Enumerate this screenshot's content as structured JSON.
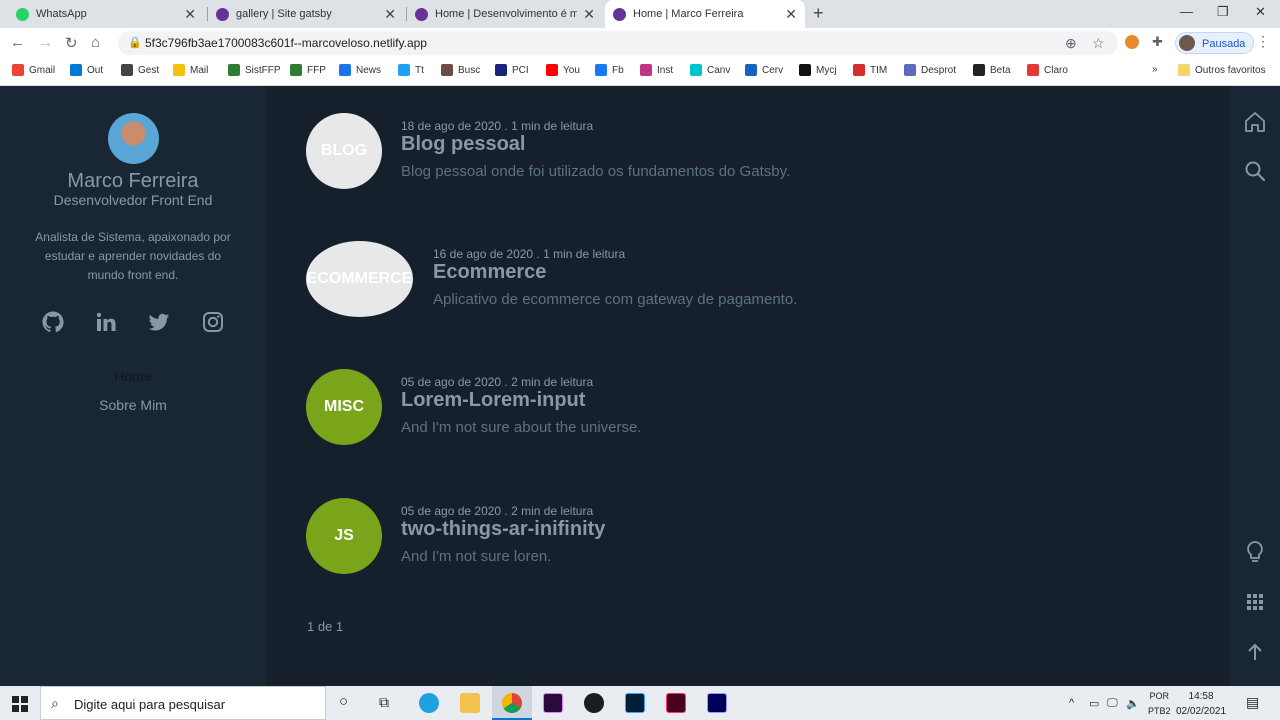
{
  "browser": {
    "tabs": [
      {
        "title": "WhatsApp",
        "active": false,
        "favicon_color": "#25d366"
      },
      {
        "title": "gallery | Site gatsby",
        "active": false,
        "favicon_color": "#663399"
      },
      {
        "title": "Home | Desenvolvimento é minh",
        "active": false,
        "favicon_color": "#663399"
      },
      {
        "title": "Home | Marco Ferreira",
        "active": true,
        "favicon_color": "#663399"
      }
    ],
    "new_tab": "+",
    "close": "✕",
    "url": "5f3c796fb3ae1700083c601f--marcoveloso.netlify.app",
    "profile_label": "Pausada",
    "bookmarks": [
      {
        "label": "Gmail",
        "color": "#ea4335"
      },
      {
        "label": "Out",
        "color": "#0078d4"
      },
      {
        "label": "Gest",
        "color": "#444444"
      },
      {
        "label": "Mail",
        "color": "#f4c20d"
      },
      {
        "label": "SistFFP",
        "color": "#2e7d32"
      },
      {
        "label": "FFP",
        "color": "#2e7d32"
      },
      {
        "label": "News",
        "color": "#1a73e8"
      },
      {
        "label": "Tt",
        "color": "#1da1f2"
      },
      {
        "label": "Busc",
        "color": "#6d4c41"
      },
      {
        "label": "PCI",
        "color": "#1a237e"
      },
      {
        "label": "You",
        "color": "#ff0000"
      },
      {
        "label": "Fb",
        "color": "#1877f2"
      },
      {
        "label": "Inst",
        "color": "#c13584"
      },
      {
        "label": "Canv",
        "color": "#00c4cc"
      },
      {
        "label": "Cerv",
        "color": "#1565c0"
      },
      {
        "label": "Mycj",
        "color": "#111111"
      },
      {
        "label": "TIM",
        "color": "#d32f2f"
      },
      {
        "label": "Desprot",
        "color": "#5c6bc0"
      },
      {
        "label": "Beta",
        "color": "#222222"
      },
      {
        "label": "Claro",
        "color": "#e53935"
      }
    ],
    "bookmarks_overflow": "»",
    "other_bookmarks": "Outros favoritos"
  },
  "sidebar": {
    "name": "Marco Ferreira",
    "role": "Desenvolvedor Front End",
    "bio": "Analista de Sistema, apaixonado por estudar e aprender novidades do mundo front end.",
    "social": [
      "github-icon",
      "linkedin-icon",
      "twitter-icon",
      "instagram-icon"
    ],
    "menu": [
      {
        "label": "Home"
      },
      {
        "label": "Sobre Mim"
      }
    ]
  },
  "posts": [
    {
      "tag": "BLOG",
      "tag_color": "#e8e8e8",
      "meta": "18 de ago de 2020 . 1 min de leitura",
      "title": "Blog pessoal",
      "description": "Blog pessoal onde foi utilizado os fundamentos do Gatsby."
    },
    {
      "tag": "ECOMMERCE",
      "tag_color": "#e8e8e8",
      "meta": "16 de ago de 2020 . 1 min de leitura",
      "title": "Ecommerce",
      "description": "Aplicativo de ecommerce com gateway de pagamento."
    },
    {
      "tag": "MISC",
      "tag_color": "#7aa51a",
      "meta": "05 de ago de 2020 . 2 min de leitura",
      "title": "Lorem-Lorem-input",
      "description": "And I'm not sure about the universe."
    },
    {
      "tag": "JS",
      "tag_color": "#7aa51a",
      "meta": "05 de ago de 2020 . 2 min de leitura",
      "title": "two-things-ar-inifinity",
      "description": "And I'm not sure loren."
    }
  ],
  "pagination": "1 de 1",
  "rightbar": [
    "home-icon",
    "search-icon",
    "lightbulb-icon",
    "grid-icon",
    "arrow-up-icon"
  ],
  "taskbar": {
    "search_placeholder": "Digite aqui para pesquisar",
    "lang_top": "POR",
    "lang_bottom": "PTB2",
    "time": "14:58",
    "date": "02/02/2021"
  }
}
